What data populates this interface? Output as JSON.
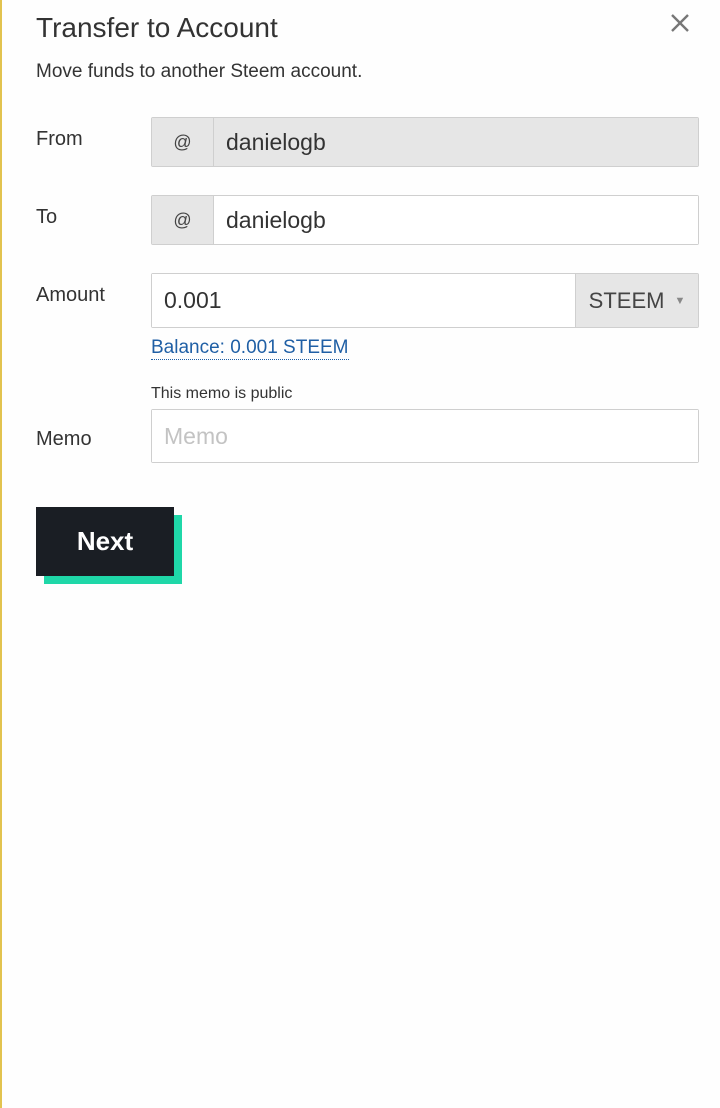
{
  "header": {
    "title": "Transfer to Account",
    "subtitle": "Move funds to another Steem account."
  },
  "form": {
    "from": {
      "label": "From",
      "prefix": "@",
      "value": "danielogb"
    },
    "to": {
      "label": "To",
      "prefix": "@",
      "value": "danielogb"
    },
    "amount": {
      "label": "Amount",
      "value": "0.001",
      "asset": "STEEM",
      "balance": "Balance: 0.001 STEEM"
    },
    "memo": {
      "label": "Memo",
      "note": "This memo is public",
      "placeholder": "Memo",
      "value": ""
    }
  },
  "actions": {
    "next_label": "Next"
  },
  "colors": {
    "accent_shadow": "#1fd7a8",
    "button_bg": "#1a1e24",
    "link": "#1f5fa5",
    "left_border": "#e2c34f"
  },
  "icons": {
    "close": "close-icon",
    "caret": "caret-down-icon"
  }
}
